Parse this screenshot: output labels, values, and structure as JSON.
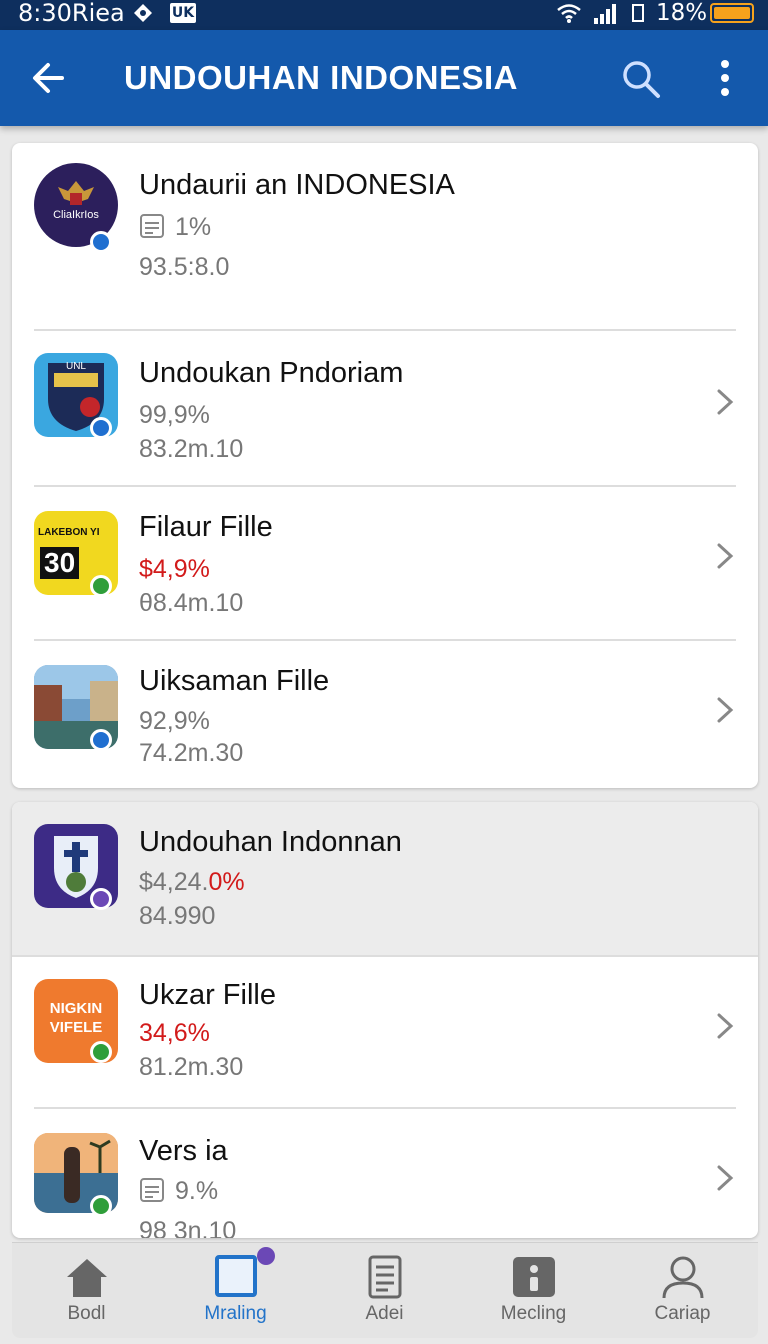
{
  "status_bar": {
    "time": "8:30Riea",
    "badge_text": "UK",
    "battery_percent": "18%",
    "battery_level": 0.18
  },
  "app_bar": {
    "title": "UNDOUHAN INDONESIA",
    "back_icon": "arrow-left-icon",
    "search_icon": "search-icon",
    "more_icon": "more-vert-icon"
  },
  "list_primary": [
    {
      "name": "Undaurii an INDONESIA",
      "percent": "1%",
      "size": "93.5:8.0",
      "percent_color": "gray",
      "has_file_icon": true,
      "thumb_text": "CliaIkrIos",
      "badge_color": "#1f6fd0"
    },
    {
      "name": "Undoukan Pndoriam",
      "percent": "99,9%",
      "size": "83.2m.10",
      "percent_color": "gray",
      "thumb_text": "UNL",
      "badge_color": "#1f6fd0"
    },
    {
      "name": "Filaur Fille",
      "percent": "$4,9%",
      "size": "θ8.4m.10",
      "percent_color": "red",
      "thumb_text": "LAKEBON YI",
      "thumb_big": "30",
      "badge_color": "#2f9e3a"
    },
    {
      "name": "Uiksaman Fille",
      "percent": "92,9%",
      "size": "74.2m.30",
      "percent_color": "gray",
      "badge_color": "#1f6fd0"
    }
  ],
  "list_secondary": [
    {
      "name": "Undouhan Indonnan",
      "percent_prefix": "$4,24.",
      "percent_suffix": "0%",
      "size": "84.990",
      "badge_color": "#6b48b6"
    },
    {
      "name": "Ukzar Fille",
      "percent": "34,6%",
      "size": "81.2m.30",
      "percent_color": "red",
      "thumb_text": "NIGKIN VIFELE",
      "badge_color": "#2f9e3a"
    },
    {
      "name": "Vers ia",
      "percent": "9.%",
      "size": "98 3n.10",
      "percent_color": "gray",
      "has_file_icon": true,
      "badge_color": "#2f9e3a"
    }
  ],
  "bottom_nav": [
    {
      "label": "Bodl",
      "icon": "home-icon",
      "active": false
    },
    {
      "label": "Mraling",
      "icon": "square-icon",
      "active": true
    },
    {
      "label": "Adei",
      "icon": "document-icon",
      "active": false
    },
    {
      "label": "Mecling",
      "icon": "info-icon",
      "active": false
    },
    {
      "label": "Cariap",
      "icon": "person-icon",
      "active": false
    }
  ],
  "colors": {
    "app_bar": "#1459ac",
    "status_bar": "#0e2f5e",
    "accent": "#2273c9",
    "warning_red": "#d21a1a"
  }
}
